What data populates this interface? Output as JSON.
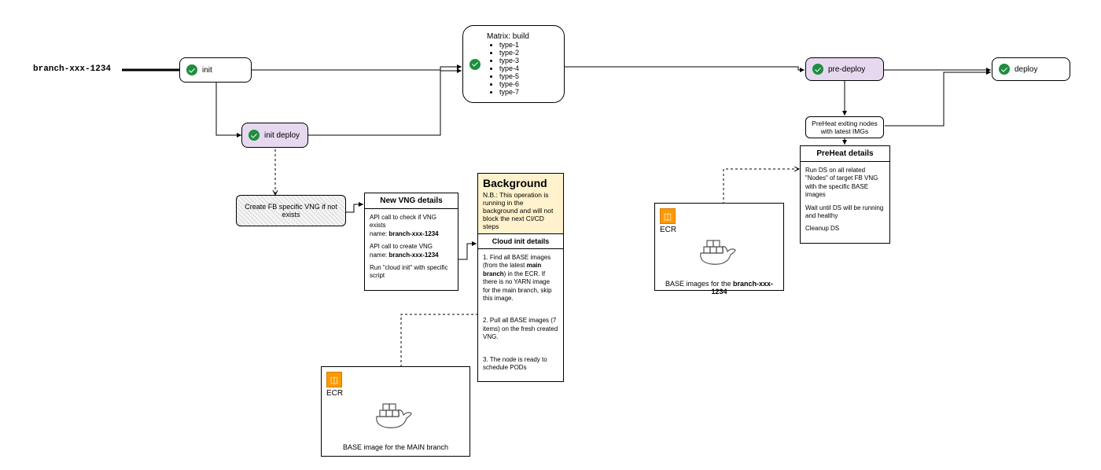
{
  "branch_label": "branch-xxx-1234",
  "nodes": {
    "init": "init",
    "init_deploy": "init deploy",
    "predeploy": "pre-deploy",
    "deploy": "deploy",
    "preheat_nodes": "PreHeat exiting nodes with latest IMGs",
    "create_vng": "Create FB specific VNG if not exists"
  },
  "matrix": {
    "title": "Matrix: build",
    "items": [
      "type-1",
      "type-2",
      "type-3",
      "type-4",
      "type-5",
      "type-6",
      "type-7"
    ]
  },
  "new_vng": {
    "header": "New VNG details",
    "l1": "API call to check if VNG exists",
    "l1b_prefix": "name: ",
    "l1b_val": "branch-xxx-1234",
    "l2": "API call to create VNG",
    "l2b_prefix": "name: ",
    "l2b_val": "branch-xxx-1234",
    "l3": "Run \"cloud init\" with specific script"
  },
  "background": {
    "title": "Background",
    "nb": "N.B.: This operation is running in the background and will not block the next CI/CD steps"
  },
  "cloud_init": {
    "header": "Cloud init details",
    "p1a": "1. Find all BASE images (from the latest ",
    "p1b": "main branch",
    "p1c": ") in the ECR. If there is no YARN image for the main branch, skip this image.",
    "p2": "2. Pull all BASE images (7 items) on the fresh created VNG.",
    "p3": "3. The node is ready to schedule PODs"
  },
  "preheat_details": {
    "header": "PreHeat details",
    "p1": "Run DS on all related \"Nodes\" of target FB VNG with the specific BASE images",
    "p2": "Wait until DS will be running and healthy",
    "p3": "Cleanup DS"
  },
  "ecr_label": "ECR",
  "ecr1_caption": "BASE image for the MAIN branch",
  "ecr2_caption_a": "BASE images for the ",
  "ecr2_caption_b": "branch-xxx-1234"
}
